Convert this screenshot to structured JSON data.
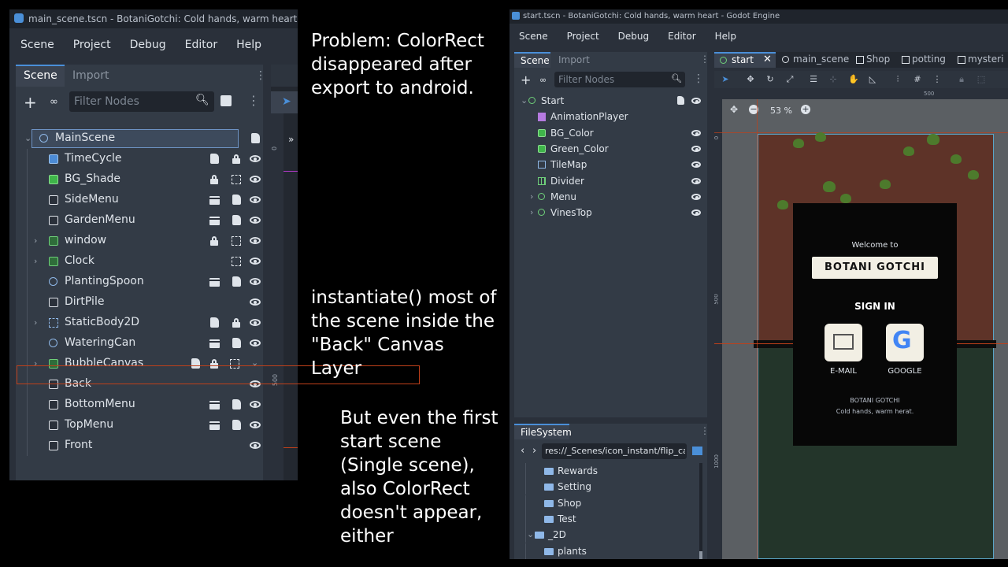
{
  "left_window": {
    "title": "main_scene.tscn - BotaniGotchi: Cold hands, warm heart - Godot",
    "menu": [
      "Scene",
      "Project",
      "Debug",
      "Editor",
      "Help"
    ],
    "dock_tabs": {
      "scene": "Scene",
      "import": "Import"
    },
    "filter_placeholder": "Filter Nodes",
    "nodes": [
      {
        "label": "MainScene"
      },
      {
        "label": "TimeCycle"
      },
      {
        "label": "BG_Shade"
      },
      {
        "label": "SideMenu"
      },
      {
        "label": "GardenMenu"
      },
      {
        "label": "window"
      },
      {
        "label": "Clock"
      },
      {
        "label": "PlantingSpoon"
      },
      {
        "label": "DirtPile"
      },
      {
        "label": "StaticBody2D"
      },
      {
        "label": "WateringCan"
      },
      {
        "label": "BubbleCanvas"
      },
      {
        "label": "Back"
      },
      {
        "label": "BottomMenu"
      },
      {
        "label": "TopMenu"
      },
      {
        "label": "Front"
      }
    ],
    "ruler_labels": {
      "top": "0",
      "side": "500"
    }
  },
  "annotations": {
    "problem": "Problem: ColorRect disappeared after export to android.",
    "instantiate": "instantiate() most of the scene inside the \"Back\" Canvas Layer",
    "but_even": "But even the first start scene (Single scene), also ColorRect doesn't appear, either"
  },
  "right_window": {
    "title": "start.tscn - BotaniGotchi: Cold hands, warm heart - Godot Engine",
    "menu": [
      "Scene",
      "Project",
      "Debug",
      "Editor",
      "Help"
    ],
    "dock_tabs": {
      "scene": "Scene",
      "import": "Import"
    },
    "filter_placeholder": "Filter Nodes",
    "nodes": [
      {
        "label": "Start"
      },
      {
        "label": "AnimationPlayer"
      },
      {
        "label": "BG_Color"
      },
      {
        "label": "Green_Color"
      },
      {
        "label": "TileMap"
      },
      {
        "label": "Divider"
      },
      {
        "label": "Menu"
      },
      {
        "label": "VinesTop"
      }
    ],
    "scene_tabs": [
      "start",
      "main_scene",
      "Shop",
      "potting",
      "mysteri"
    ],
    "zoom": "53 %",
    "ruler": {
      "top": "500",
      "side_top": "0",
      "side_mid": "500",
      "side_bottom": "1000"
    },
    "filesystem": {
      "tab": "FileSystem",
      "path": "res://_Scenes/icon_instant/flip_car",
      "items": [
        "Rewards",
        "Setting",
        "Shop",
        "Test",
        "_2D",
        "plants"
      ]
    },
    "game": {
      "welcome": "Welcome to",
      "title": "BOTANI GOTCHI",
      "signin": "SIGN IN",
      "email": "E-MAIL",
      "google": "GOOGLE",
      "footer1": "BOTANI GOTCHI",
      "footer2": "Cold hands, warm herat."
    }
  },
  "colors": {
    "highlight_box": "#c0401a",
    "accent_blue": "#4a8fd8",
    "panel_bg": "#2a303a",
    "brown": "#5e3328",
    "dark_green": "#23352a"
  }
}
